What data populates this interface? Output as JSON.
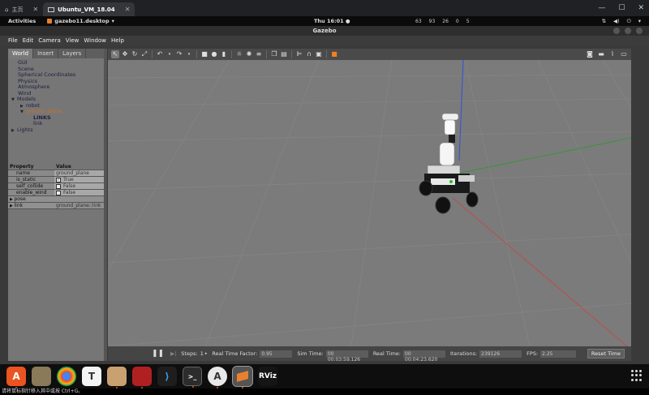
{
  "browser": {
    "tabs": [
      {
        "label": "主页",
        "icon": "home-icon"
      },
      {
        "label": "Ubuntu_VM_18.04",
        "icon": "vm-icon"
      }
    ]
  },
  "panel": {
    "activities": "Activities",
    "app_name": "gazebo11.desktop",
    "clock": "Thu 16:01",
    "stats": [
      "63",
      "93",
      "26",
      "0",
      "5"
    ]
  },
  "window": {
    "title": "Gazebo"
  },
  "menu": [
    "File",
    "Edit",
    "Camera",
    "View",
    "Window",
    "Help"
  ],
  "left_panel": {
    "tabs": [
      "World",
      "Insert",
      "Layers"
    ],
    "tree": {
      "gui": "GUI",
      "scene": "Scene",
      "spherical": "Spherical Coordinates",
      "physics": "Physics",
      "atmosphere": "Atmosphere",
      "wind": "Wind",
      "models": "Models",
      "robot": "robot",
      "ground_plane": "ground_plane",
      "links_header": "LINKS",
      "link": "link",
      "lights": "Lights"
    },
    "properties": {
      "header_key": "Property",
      "header_value": "Value",
      "name_key": "name",
      "name_value": "ground_plane",
      "is_static_key": "is_static",
      "is_static_value": "True",
      "self_collide_key": "self_collide",
      "self_collide_value": "False",
      "enable_wind_key": "enable_wind",
      "enable_wind_value": "False",
      "pose_key": "pose",
      "link_key": "link",
      "link_value": "ground_plane::link"
    }
  },
  "status": {
    "steps_label": "Steps:",
    "steps_value": "1",
    "rtf_label": "Real Time Factor:",
    "rtf_value": "0.95",
    "sim_time_label": "Sim Time:",
    "sim_time_value": "00 00:03:59.126",
    "real_time_label": "Real Time:",
    "real_time_value": "00 00:04:23.620",
    "iterations_label": "Iterations:",
    "iterations_value": "239126",
    "fps_label": "FPS:",
    "fps_value": "2.25",
    "reset_label": "Reset Time"
  },
  "dock": [
    "A",
    "",
    "",
    "T",
    "",
    "",
    "",
    ">_",
    "A",
    "",
    "RViz"
  ],
  "bottom_text": "请将鼠标指针移入其中或按 Ctrl+G。"
}
